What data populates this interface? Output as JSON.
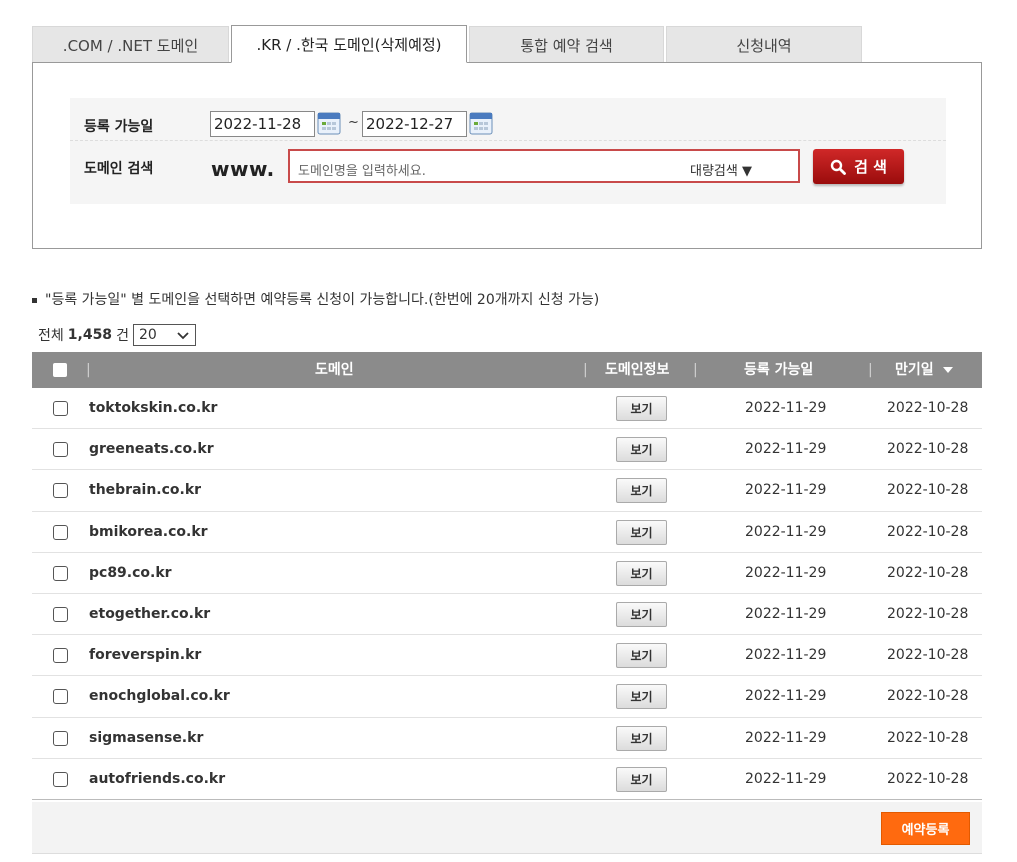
{
  "tabs": [
    {
      "label": ".COM / .NET 도메인",
      "active": false
    },
    {
      "label": ".KR / .한국 도메인(삭제예정)",
      "active": true
    },
    {
      "label": "통합 예약 검색",
      "active": false
    },
    {
      "label": "신청내역",
      "active": false
    }
  ],
  "search": {
    "date_label": "등록 가능일",
    "date_from": "2022-11-28",
    "date_sep": "~",
    "date_to": "2022-12-27",
    "domain_label": "도메인 검색",
    "www": "www.",
    "placeholder": "도메인명을 입력하세요.",
    "bulk_label": "대량검색 ▼",
    "button_label": "검 색"
  },
  "info_text": "\"등록 가능일\" 별 도메인을 선택하면 예약등록 신청이 가능합니다.(한번에 20개까지 신청 가능)",
  "total": {
    "prefix": "전체",
    "count": "1,458",
    "suffix": "건",
    "page_size": "20"
  },
  "table": {
    "headers": {
      "domain": "도메인",
      "info": "도메인정보",
      "available": "등록 가능일",
      "expiry": "만기일"
    },
    "rows": [
      {
        "domain": "toktokskin.co.kr",
        "view": "보기",
        "available": "2022-11-29",
        "expiry": "2022-10-28"
      },
      {
        "domain": "greeneats.co.kr",
        "view": "보기",
        "available": "2022-11-29",
        "expiry": "2022-10-28"
      },
      {
        "domain": "thebrain.co.kr",
        "view": "보기",
        "available": "2022-11-29",
        "expiry": "2022-10-28"
      },
      {
        "domain": "bmikorea.co.kr",
        "view": "보기",
        "available": "2022-11-29",
        "expiry": "2022-10-28"
      },
      {
        "domain": "pc89.co.kr",
        "view": "보기",
        "available": "2022-11-29",
        "expiry": "2022-10-28"
      },
      {
        "domain": "etogether.co.kr",
        "view": "보기",
        "available": "2022-11-29",
        "expiry": "2022-10-28"
      },
      {
        "domain": "foreverspin.kr",
        "view": "보기",
        "available": "2022-11-29",
        "expiry": "2022-10-28"
      },
      {
        "domain": "enochglobal.co.kr",
        "view": "보기",
        "available": "2022-11-29",
        "expiry": "2022-10-28"
      },
      {
        "domain": "sigmasense.kr",
        "view": "보기",
        "available": "2022-11-29",
        "expiry": "2022-10-28"
      },
      {
        "domain": "autofriends.co.kr",
        "view": "보기",
        "available": "2022-11-29",
        "expiry": "2022-10-28"
      }
    ]
  },
  "reserve_button": "예약등록",
  "colors": {
    "accent_red": "#c81e1e",
    "header_gray": "#8b8b8b",
    "reserve_orange": "#ff6a0f"
  }
}
